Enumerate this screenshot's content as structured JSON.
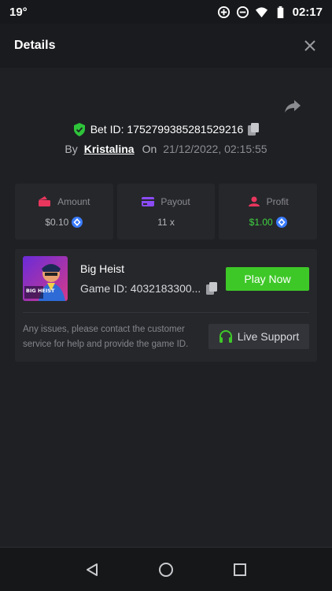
{
  "status_bar": {
    "temperature": "19°",
    "time": "02:17"
  },
  "header": {
    "title": "Details"
  },
  "bet": {
    "id_label": "Bet ID: 1752799385281529216",
    "by_label": "By",
    "user": "Kristalina",
    "on_label": "On",
    "date": "21/12/2022, 02:15:55"
  },
  "stats": [
    {
      "label": "Amount",
      "value": "$0.10",
      "icon": "wallet-icon",
      "color": "#e8365d"
    },
    {
      "label": "Payout",
      "value": "11 x",
      "icon": "card-icon",
      "color": "#8a4bf5"
    },
    {
      "label": "Profit",
      "value": "$1.00",
      "icon": "user-icon",
      "color": "#e8365d"
    }
  ],
  "game": {
    "name": "Big Heist",
    "id_label": "Game ID: 4032183300...",
    "play_label": "Play Now",
    "thumb_text": "BIG HEIST",
    "notice": "Any issues, please contact the customer service for help and provide the game ID.",
    "support_label": "Live Support"
  },
  "colors": {
    "accent": "#3ec828",
    "background": "#1f2024",
    "card": "#26272b",
    "coin": "#3a7cff"
  }
}
